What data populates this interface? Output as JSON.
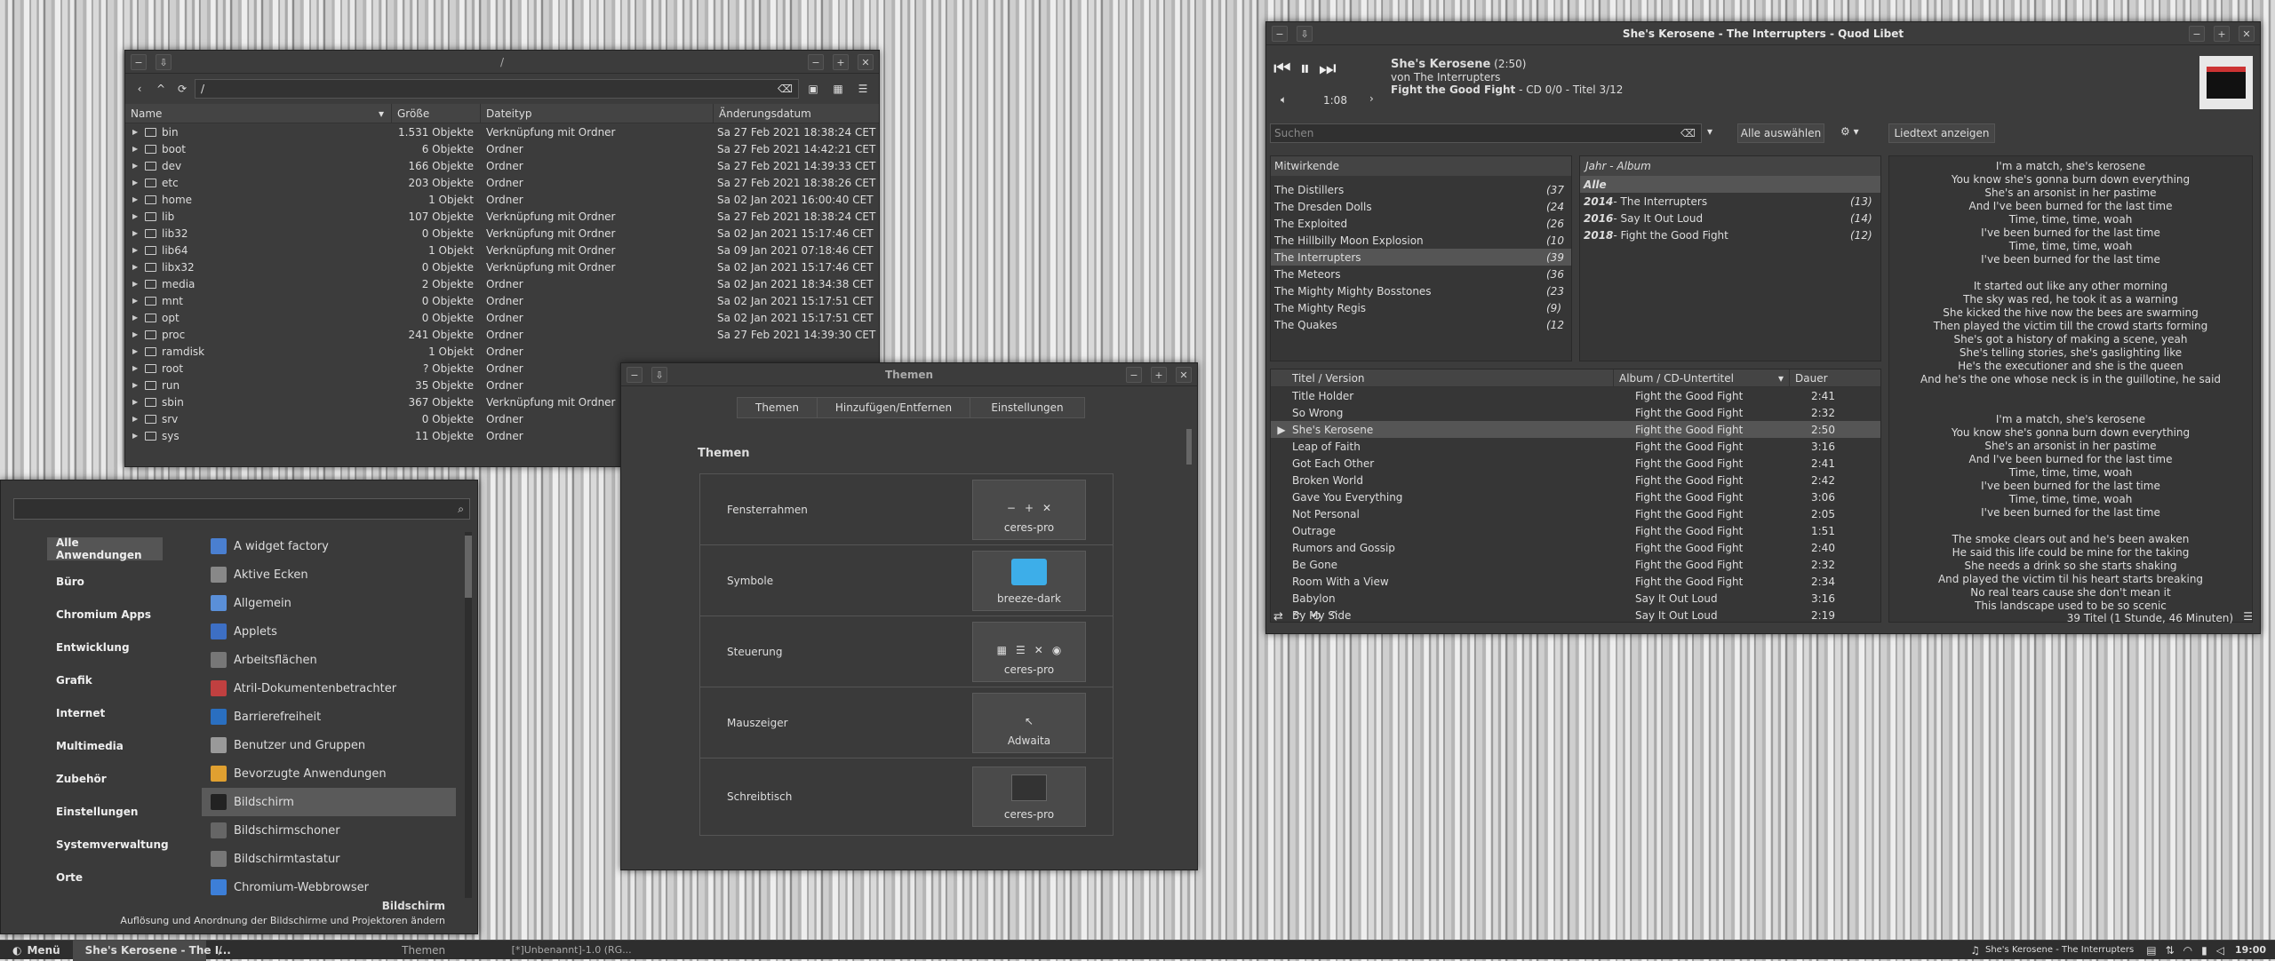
{
  "file_manager": {
    "title": "/",
    "path": "/",
    "columns": [
      "Name",
      "Größe",
      "Dateityp",
      "Änderungsdatum"
    ],
    "rows": [
      [
        "bin",
        "1.531 Objekte",
        "Verknüpfung mit Ordner",
        "Sa 27 Feb 2021 18:38:24 CET"
      ],
      [
        "boot",
        "6 Objekte",
        "Ordner",
        "Sa 27 Feb 2021 14:42:21 CET"
      ],
      [
        "dev",
        "166 Objekte",
        "Ordner",
        "Sa 27 Feb 2021 14:39:33 CET"
      ],
      [
        "etc",
        "203 Objekte",
        "Ordner",
        "Sa 27 Feb 2021 18:38:26 CET"
      ],
      [
        "home",
        "1 Objekt",
        "Ordner",
        "Sa 02 Jan 2021 16:00:40 CET"
      ],
      [
        "lib",
        "107 Objekte",
        "Verknüpfung mit Ordner",
        "Sa 27 Feb 2021 18:38:24 CET"
      ],
      [
        "lib32",
        "0 Objekte",
        "Verknüpfung mit Ordner",
        "Sa 02 Jan 2021 15:17:46 CET"
      ],
      [
        "lib64",
        "1 Objekt",
        "Verknüpfung mit Ordner",
        "Sa 09 Jan 2021 07:18:46 CET"
      ],
      [
        "libx32",
        "0 Objekte",
        "Verknüpfung mit Ordner",
        "Sa 02 Jan 2021 15:17:46 CET"
      ],
      [
        "media",
        "2 Objekte",
        "Ordner",
        "Sa 02 Jan 2021 18:34:38 CET"
      ],
      [
        "mnt",
        "0 Objekte",
        "Ordner",
        "Sa 02 Jan 2021 15:17:51 CET"
      ],
      [
        "opt",
        "0 Objekte",
        "Ordner",
        "Sa 02 Jan 2021 15:17:51 CET"
      ],
      [
        "proc",
        "241 Objekte",
        "Ordner",
        "Sa 27 Feb 2021 14:39:30 CET"
      ],
      [
        "ramdisk",
        "1 Objekt",
        "Ordner",
        ""
      ],
      [
        "root",
        "? Objekte",
        "Ordner",
        ""
      ],
      [
        "run",
        "35 Objekte",
        "Ordner",
        ""
      ],
      [
        "sbin",
        "367 Objekte",
        "Verknüpfung mit Ordner",
        ""
      ],
      [
        "srv",
        "0 Objekte",
        "Ordner",
        ""
      ],
      [
        "sys",
        "11 Objekte",
        "Ordner",
        ""
      ]
    ]
  },
  "menu": {
    "search_placeholder": "",
    "categories": [
      "Alle Anwendungen",
      "Büro",
      "Chromium Apps",
      "Entwicklung",
      "Grafik",
      "Internet",
      "Multimedia",
      "Zubehör",
      "Einstellungen",
      "Systemverwaltung",
      "Orte"
    ],
    "apps": [
      {
        "label": "A widget factory",
        "color": "#4a7fd0"
      },
      {
        "label": "Aktive Ecken",
        "color": "#888"
      },
      {
        "label": "Allgemein",
        "color": "#5a8fd8"
      },
      {
        "label": "Applets",
        "color": "#3d6fc4"
      },
      {
        "label": "Arbeitsflächen",
        "color": "#777"
      },
      {
        "label": "Atril-Dokumentenbetrachter",
        "color": "#c04040"
      },
      {
        "label": "Barrierefreiheit",
        "color": "#2a6fc0"
      },
      {
        "label": "Benutzer und Gruppen",
        "color": "#999"
      },
      {
        "label": "Bevorzugte Anwendungen",
        "color": "#e0a030"
      },
      {
        "label": "Bildschirm",
        "color": "#222"
      },
      {
        "label": "Bildschirmschoner",
        "color": "#666"
      },
      {
        "label": "Bildschirmtastatur",
        "color": "#777"
      },
      {
        "label": "Chromium-Webbrowser",
        "color": "#3d7fd8"
      }
    ],
    "footer_title": "Bildschirm",
    "footer_desc": "Auflösung und Anordnung der Bildschirme und Projektoren ändern"
  },
  "themes": {
    "title": "Themen",
    "tabs": [
      "Themen",
      "Hinzufügen/Entfernen",
      "Einstellungen"
    ],
    "heading": "Themen",
    "rows": [
      {
        "label": "Fensterrahmen",
        "value": "ceres-pro"
      },
      {
        "label": "Symbole",
        "value": "breeze-dark"
      },
      {
        "label": "Steuerung",
        "value": "ceres-pro"
      },
      {
        "label": "Mauszeiger",
        "value": "Adwaita"
      },
      {
        "label": "Schreibtisch",
        "value": "ceres-pro"
      }
    ]
  },
  "quodlibet": {
    "title": "She's Kerosene - The Interrupters - Quod Libet",
    "song": "She's Kerosene",
    "duration": "(2:50)",
    "by": "von The Interrupters",
    "album": "Fight the Good Fight",
    "album_meta": " - CD 0/0 - Titel 3/12",
    "pos": "1:08",
    "search_placeholder": "Suchen",
    "select_all": "Alle auswählen",
    "lyrics_btn": "Liedtext anzeigen",
    "artists_header": "Mitwirkende",
    "artists": [
      [
        "The Distillers",
        "(37"
      ],
      [
        "The Dresden Dolls",
        "(24"
      ],
      [
        "The Exploited",
        "(26"
      ],
      [
        "The Hillbilly Moon Explosion",
        "(10"
      ],
      [
        "The Interrupters",
        "(39"
      ],
      [
        "The Meteors",
        "(36"
      ],
      [
        "The Mighty Mighty Bosstones",
        "(23"
      ],
      [
        "The Mighty Regis",
        "(9)"
      ],
      [
        "The Quakes",
        "(12"
      ]
    ],
    "albums_header": "Jahr - Album",
    "albums": [
      [
        "Alle",
        "",
        ""
      ],
      [
        "2014",
        " - The Interrupters",
        "(13)"
      ],
      [
        "2016",
        " - Say It Out Loud",
        "(14)"
      ],
      [
        "2018",
        " - Fight the Good Fight",
        "(12)"
      ]
    ],
    "track_cols": [
      "Titel / Version",
      "Album / CD-Untertitel",
      "Dauer"
    ],
    "tracks": [
      [
        "Title Holder",
        "Fight the Good Fight",
        "2:41"
      ],
      [
        "So Wrong",
        "Fight the Good Fight",
        "2:32"
      ],
      [
        "She's Kerosene",
        "Fight the Good Fight",
        "2:50"
      ],
      [
        "Leap of Faith",
        "Fight the Good Fight",
        "3:16"
      ],
      [
        "Got Each Other",
        "Fight the Good Fight",
        "2:41"
      ],
      [
        "Broken World",
        "Fight the Good Fight",
        "2:42"
      ],
      [
        "Gave You Everything",
        "Fight the Good Fight",
        "3:06"
      ],
      [
        "Not Personal",
        "Fight the Good Fight",
        "2:05"
      ],
      [
        "Outrage",
        "Fight the Good Fight",
        "1:51"
      ],
      [
        "Rumors and Gossip",
        "Fight the Good Fight",
        "2:40"
      ],
      [
        "Be Gone",
        "Fight the Good Fight",
        "2:32"
      ],
      [
        "Room With a View",
        "Fight the Good Fight",
        "2:34"
      ],
      [
        "Babylon",
        "Say It Out Loud",
        "3:16"
      ],
      [
        "By My Side",
        "Say It Out Loud",
        "2:19"
      ]
    ],
    "status": "39 Titel (1 Stunde, 46 Minuten)",
    "lyrics": [
      "I'm a match, she's kerosene",
      "You know she's gonna burn down everything",
      "She's an arsonist in her pastime",
      "And I've been burned for the last time",
      "Time, time, time, woah",
      "I've been burned for the last time",
      "Time, time, time, woah",
      "I've been burned for the last time",
      "",
      "It started out like any other morning",
      "The sky was red, he took it as a warning",
      "She kicked the hive now the bees are swarming",
      "Then played the victim till the crowd starts forming",
      "She's got a history of making a scene, yeah",
      "She's telling stories, she's gaslighting like",
      "He's the executioner and she is the queen",
      "And he's the one whose neck is in the guillotine, he said",
      "",
      "",
      "I'm a match, she's kerosene",
      "You know she's gonna burn down everything",
      "She's an arsonist in her pastime",
      "And I've been burned for the last time",
      "Time, time, time, woah",
      "I've been burned for the last time",
      "Time, time, time, woah",
      "I've been burned for the last time",
      "",
      "The smoke clears out and he's been awaken",
      "He said this life could be mine for the taking",
      "She needs a drink so she starts shaking",
      "And played the victim til his heart starts breaking",
      "No real tears cause she don't mean it",
      "This landscape used to be so scenic"
    ]
  },
  "taskbar": {
    "menu": "Menü",
    "items": [
      "She's Kerosene - The I...",
      "/",
      "Themen",
      "[*]Unbenannt]-1.0 (RG..."
    ],
    "now_playing": "She's Kerosene - The Interrupters",
    "clock": "19:00"
  }
}
